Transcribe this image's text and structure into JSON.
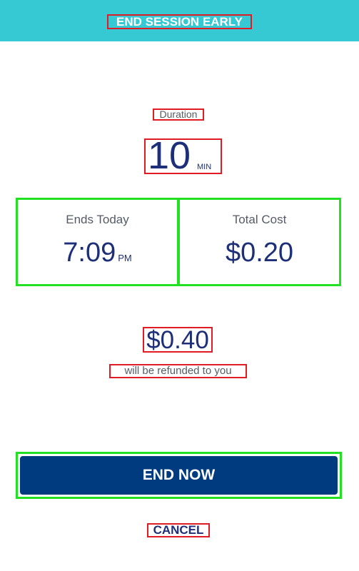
{
  "header": {
    "title": "END SESSION EARLY"
  },
  "duration": {
    "label": "Duration",
    "value": "10",
    "unit": "MIN"
  },
  "ends": {
    "label": "Ends Today",
    "time": "7:09",
    "suffix": "PM"
  },
  "total": {
    "label": "Total Cost",
    "value": "$0.20"
  },
  "refund": {
    "amount": "$0.40",
    "text": "will be refunded to you"
  },
  "actions": {
    "end_now": "END NOW",
    "cancel": "CANCEL"
  },
  "colors": {
    "header_bg": "#36c9d3",
    "primary": "#003b7f",
    "value_text": "#1d2f78",
    "muted_text": "#555b66"
  }
}
